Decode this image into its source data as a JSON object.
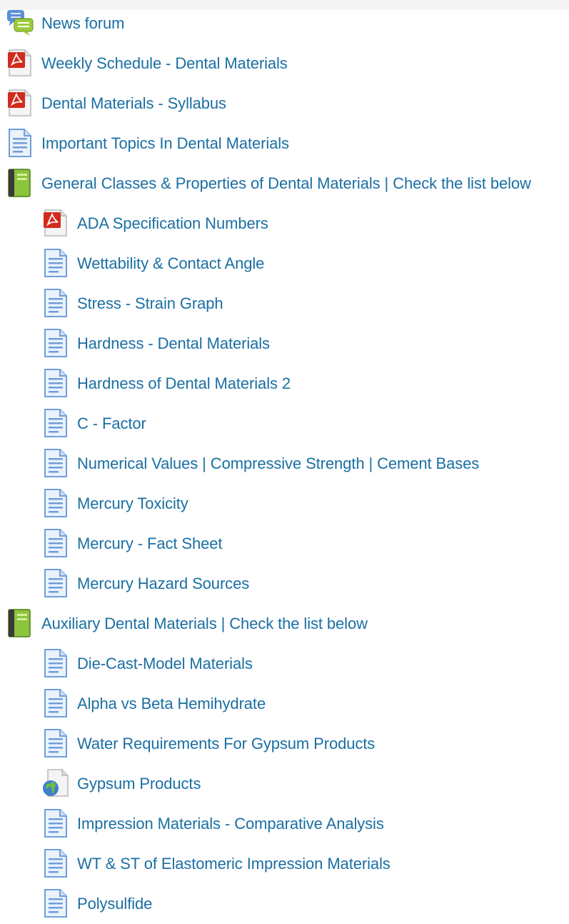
{
  "activities": [
    {
      "label": "News forum",
      "icon": "forum-icon",
      "level": 0
    },
    {
      "label": "Weekly Schedule - Dental Materials",
      "icon": "pdf-icon",
      "level": 0
    },
    {
      "label": "Dental Materials - Syllabus",
      "icon": "pdf-icon",
      "level": 0
    },
    {
      "label": "Important Topics In Dental Materials",
      "icon": "page-icon",
      "level": 0
    },
    {
      "label": "General Classes & Properties of Dental Materials | Check the list below",
      "icon": "book-icon",
      "level": 0
    },
    {
      "label": "ADA Specification Numbers",
      "icon": "pdf-icon",
      "level": 1
    },
    {
      "label": "Wettability & Contact Angle",
      "icon": "page-icon",
      "level": 1
    },
    {
      "label": "Stress - Strain Graph",
      "icon": "page-icon",
      "level": 1
    },
    {
      "label": "Hardness - Dental Materials",
      "icon": "page-icon",
      "level": 1
    },
    {
      "label": "Hardness of Dental Materials 2",
      "icon": "page-icon",
      "level": 1
    },
    {
      "label": "C - Factor",
      "icon": "page-icon",
      "level": 1
    },
    {
      "label": "Numerical Values | Compressive Strength | Cement Bases",
      "icon": "page-icon",
      "level": 1
    },
    {
      "label": "Mercury Toxicity",
      "icon": "page-icon",
      "level": 1
    },
    {
      "label": "Mercury - Fact Sheet",
      "icon": "page-icon",
      "level": 1
    },
    {
      "label": "Mercury Hazard Sources",
      "icon": "page-icon",
      "level": 1
    },
    {
      "label": "Auxiliary Dental Materials | Check the list below",
      "icon": "book-icon",
      "level": 0
    },
    {
      "label": "Die-Cast-Model Materials",
      "icon": "page-icon",
      "level": 1
    },
    {
      "label": "Alpha vs Beta Hemihydrate",
      "icon": "page-icon",
      "level": 1
    },
    {
      "label": "Water Requirements For Gypsum Products",
      "icon": "page-icon",
      "level": 1
    },
    {
      "label": "Gypsum Products",
      "icon": "url-icon",
      "level": 1
    },
    {
      "label": "Impression Materials - Comparative Analysis",
      "icon": "page-icon",
      "level": 1
    },
    {
      "label": "WT & ST of Elastomeric Impression Materials",
      "icon": "page-icon",
      "level": 1
    },
    {
      "label": "Polysulfide",
      "icon": "page-icon",
      "level": 1
    }
  ],
  "colors": {
    "link": "#1a6fa3",
    "pdf_red": "#d42a1e",
    "page_blue": "#6f9fd8",
    "book_green": "#8cc43c",
    "forum_green": "#9ccc3c"
  }
}
